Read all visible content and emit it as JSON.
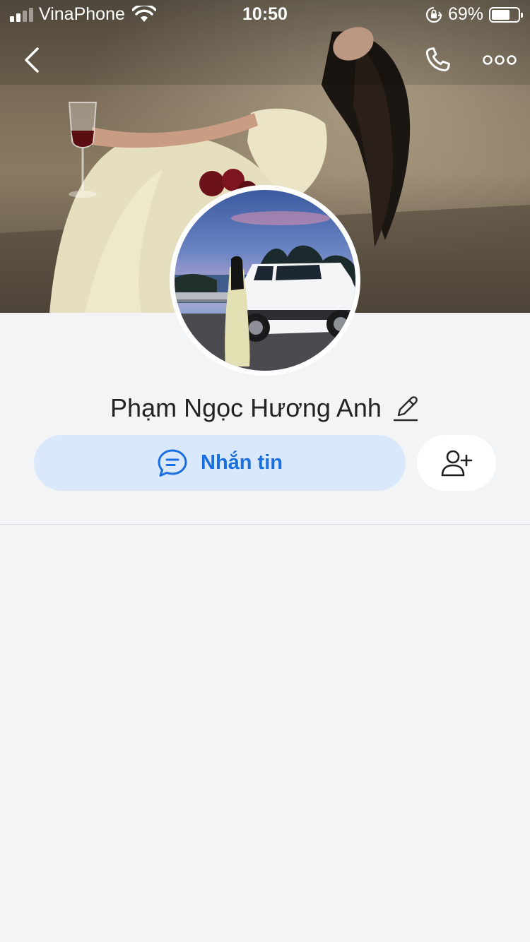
{
  "status_bar": {
    "carrier": "VinaPhone",
    "time": "10:50",
    "battery_percent": "69%",
    "battery_level": 0.69,
    "signal_bars": 2
  },
  "nav": {
    "back_icon": "chevron-left-icon",
    "call_icon": "phone-icon",
    "more_icon": "more-dots-icon"
  },
  "profile": {
    "name": "Phạm Ngọc Hương Anh",
    "edit_icon": "pencil-icon"
  },
  "actions": {
    "message_label": "Nhắn tin",
    "message_icon": "chat-bubble-icon",
    "add_friend_icon": "add-person-icon"
  },
  "colors": {
    "accent": "#1a6fe0",
    "message_button_bg": "#dae8fb",
    "page_bg": "#f3f4f6"
  }
}
